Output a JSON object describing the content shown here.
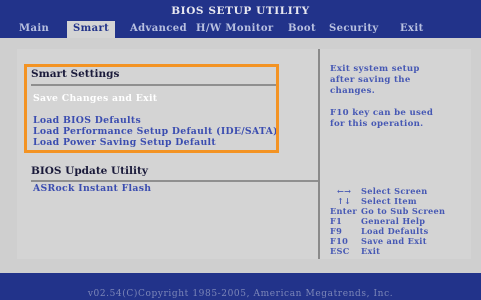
{
  "title": "BIOS SETUP UTILITY",
  "menu": {
    "main": "Main",
    "smart": "Smart",
    "advanced": "Advanced",
    "hw_monitor": "H/W Monitor",
    "boot": "Boot",
    "security": "Security",
    "exit": "Exit"
  },
  "smart_settings": {
    "heading": "Smart Settings",
    "save_changes_and_exit": "Save Changes and Exit",
    "load_bios_defaults": "Load BIOS Defaults",
    "load_performance_default": "Load Performance Setup Default (IDE/SATA)",
    "load_power_saving_default": "Load Power Saving Setup Default"
  },
  "bios_update": {
    "heading": "BIOS Update Utility",
    "asrock_instant_flash": "ASRock Instant Flash"
  },
  "help": {
    "line1": "Exit system setup",
    "line2": "after saving the",
    "line3": "changes.",
    "line4": "F10 key can be used",
    "line5": "for this operation."
  },
  "keys": [
    {
      "key": "←→",
      "desc": "Select Screen"
    },
    {
      "key": "↑↓",
      "desc": "Select Item"
    },
    {
      "key": "Enter",
      "desc": "Go to Sub Screen"
    },
    {
      "key": "F1",
      "desc": "General Help"
    },
    {
      "key": "F9",
      "desc": "Load Defaults"
    },
    {
      "key": "F10",
      "desc": "Save and Exit"
    },
    {
      "key": "ESC",
      "desc": "Exit"
    }
  ],
  "copyright": "v02.54(C)Copyright 1985-2005, American Megatrends, Inc.",
  "colors": {
    "bar_blue": "#22338a",
    "option_blue": "#3b4db0",
    "highlight_orange": "#f39323",
    "panel_grey": "#d4d4d4"
  }
}
